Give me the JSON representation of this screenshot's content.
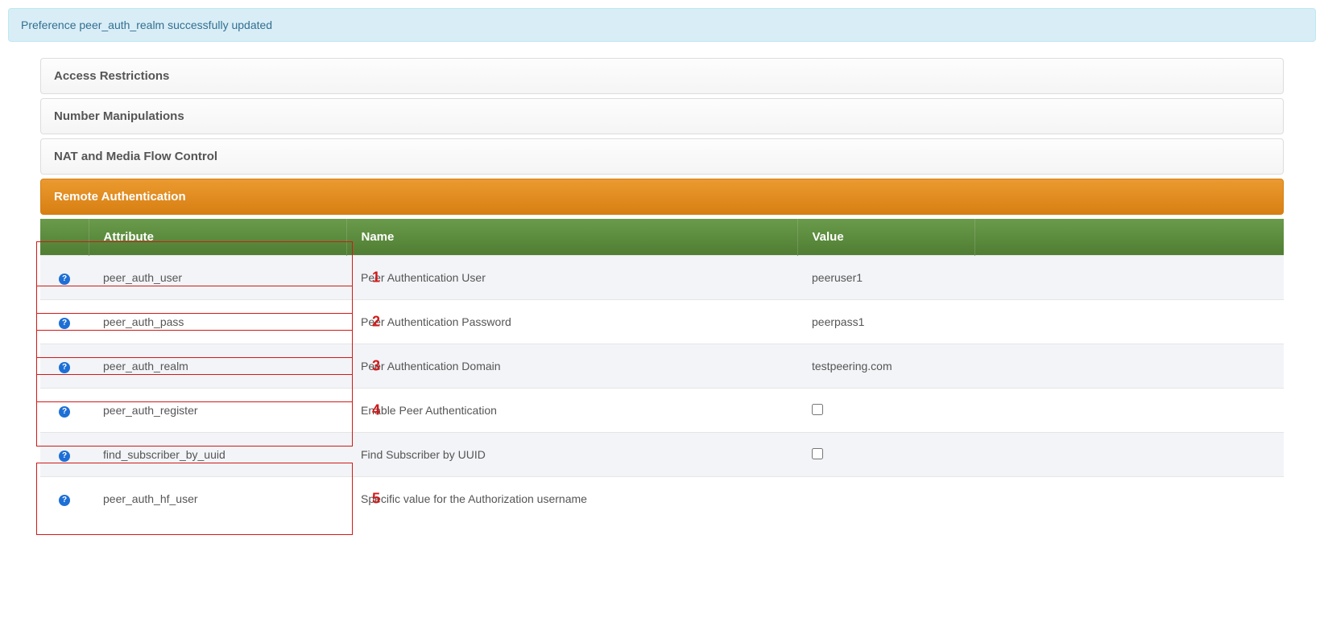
{
  "alert": {
    "text": "Preference peer_auth_realm successfully updated"
  },
  "panels": [
    {
      "label": "Access Restrictions"
    },
    {
      "label": "Number Manipulations"
    },
    {
      "label": "NAT and Media Flow Control"
    },
    {
      "label": "Remote Authentication"
    }
  ],
  "table": {
    "headers": {
      "attribute": "Attribute",
      "name": "Name",
      "value": "Value"
    },
    "rows": [
      {
        "attr": "peer_auth_user",
        "name": "Peer Authentication User",
        "value": "peeruser1",
        "annot": "1",
        "type": "text"
      },
      {
        "attr": "peer_auth_pass",
        "name": "Peer Authentication Password",
        "value": "peerpass1",
        "annot": "2",
        "type": "text"
      },
      {
        "attr": "peer_auth_realm",
        "name": "Peer Authentication Domain",
        "value": "testpeering.com",
        "annot": "3",
        "type": "text"
      },
      {
        "attr": "peer_auth_register",
        "name": "Enable Peer Authentication",
        "value": "",
        "annot": "4",
        "type": "checkbox"
      },
      {
        "attr": "find_subscriber_by_uuid",
        "name": "Find Subscriber by UUID",
        "value": "",
        "annot": "",
        "type": "checkbox"
      },
      {
        "attr": "peer_auth_hf_user",
        "name": "Specific value for the Authorization username",
        "value": "",
        "annot": "5",
        "type": "text"
      }
    ]
  }
}
